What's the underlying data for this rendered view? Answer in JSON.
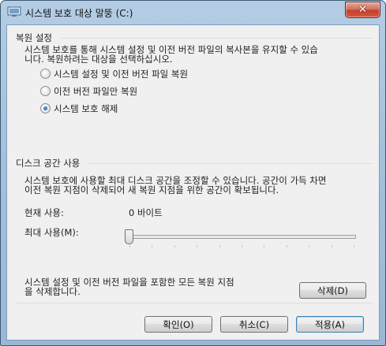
{
  "window": {
    "title": "시스템 보호 대상 말뚱 (C:)",
    "close_symbol": "✕"
  },
  "restore_settings": {
    "heading": "복원 설정",
    "description_line1": "시스템 보호를 통해 시스템 설정 및 이전 버전 파일의 복사본을 유지할 수 있습",
    "description_line2": "니다. 복원하려는 대상을 선택하십시오.",
    "options": [
      {
        "label": "시스템 설정 및 이전 버전 파일 복원",
        "checked": false
      },
      {
        "label": "이전 버전 파일만 복원",
        "checked": false
      },
      {
        "label": "시스템 보호 해제",
        "checked": true
      }
    ]
  },
  "disk_usage": {
    "heading": "디스크 공간 사용",
    "description_line1": "시스템 보호에 사용할 최대 디스크 공간을 조정할 수 있습니다. 공간이 가득 차면",
    "description_line2": "이전 복원 지점이 삭제되어 새 복원 지점을 위한 공간이 확보됩니다.",
    "current_label": "현재 사용:",
    "current_value": "0 바이트",
    "max_label": "최대 사용(M):",
    "max_fraction": 0.0
  },
  "delete_section": {
    "text_line1": "시스템 설정 및 이전 버전 파일을 포함한 모든 복원 지점",
    "text_line2": "을 삭제합니다.",
    "delete_button": "삭제(D)"
  },
  "footer": {
    "ok_button": "확인(O)",
    "cancel_button": "취소(C)",
    "apply_button": "적용(A)"
  }
}
